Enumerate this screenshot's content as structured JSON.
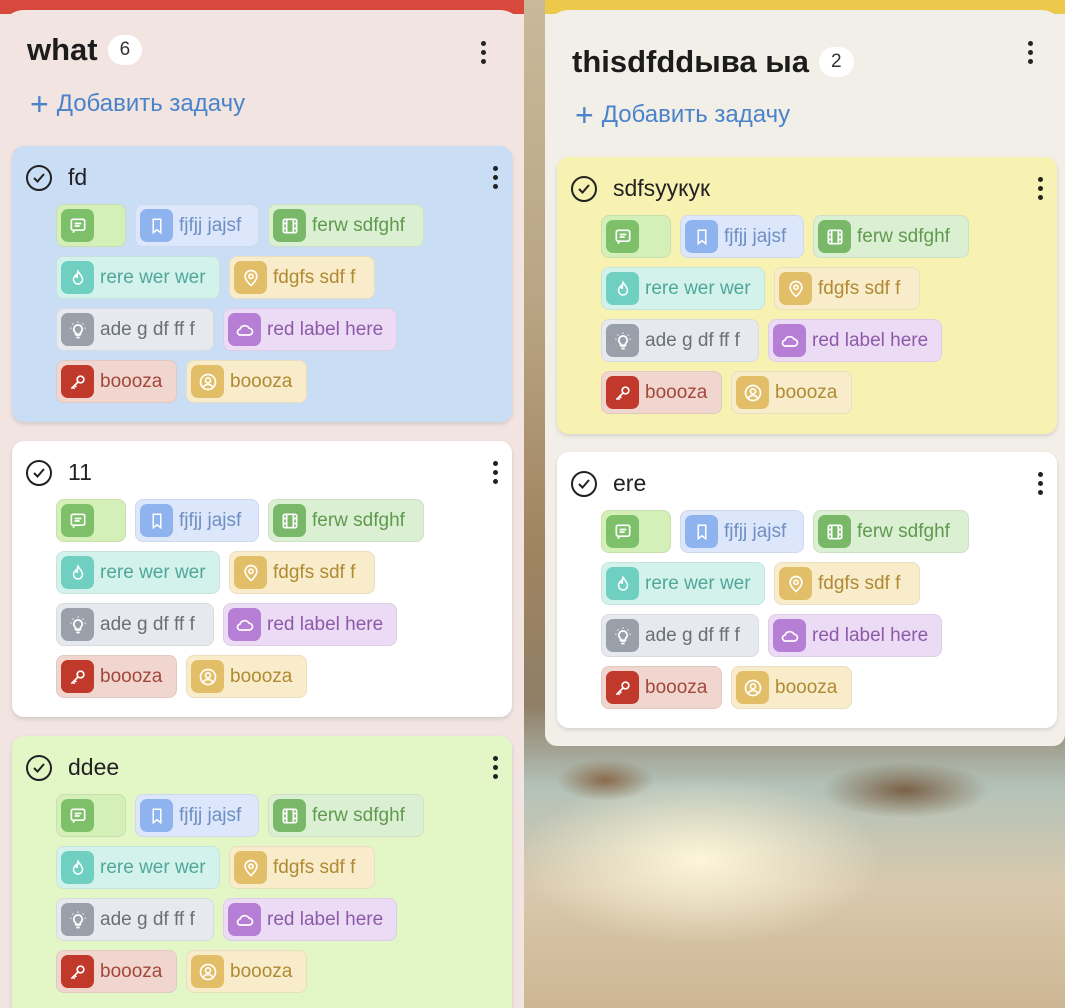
{
  "columns": [
    {
      "title": "what",
      "count": "6",
      "add_task": "Добавить задачу",
      "cards": [
        {
          "title": "fd"
        },
        {
          "title": "11"
        },
        {
          "title": "ddee"
        }
      ]
    },
    {
      "title": "thisdfddыва ыа",
      "count": "2",
      "add_task": "Добавить задачу",
      "cards": [
        {
          "title": "sdfsyукук"
        },
        {
          "title": "ere"
        }
      ]
    }
  ],
  "labels": {
    "bookmark": "fjfjj jajsf",
    "film": "ferw sdfghf",
    "fire": "rere wer wer",
    "pin": "fdgfs sdf f",
    "bulb": "ade g df ff f",
    "cloud": "red label here",
    "key": "boooza",
    "user": "boooza"
  },
  "colors": {
    "column_0_accent": "#d9483c",
    "column_1_accent": "#ecc94a",
    "add_task": "#4a83c9",
    "card_blue": "#c9ddf4",
    "card_white": "#ffffff",
    "card_green": "#e3f6c5",
    "card_yellow": "#f8f2b2"
  }
}
